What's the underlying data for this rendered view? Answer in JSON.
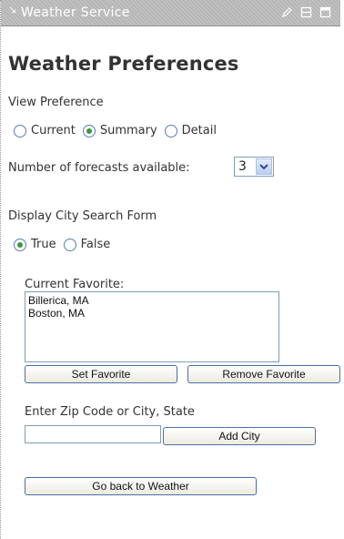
{
  "titlebar": {
    "collapse_glyph": "↘",
    "title": "Weather Service",
    "icons": [
      "edit-icon",
      "minimize-icon",
      "maximize-icon"
    ]
  },
  "heading": "Weather Preferences",
  "view_preference": {
    "label": "View Preference",
    "options": [
      {
        "label": "Current",
        "checked": false
      },
      {
        "label": "Summary",
        "checked": true
      },
      {
        "label": "Detail",
        "checked": false
      }
    ]
  },
  "forecasts": {
    "label": "Number of forecasts available:",
    "selected": "3"
  },
  "city_search": {
    "label": "Display City Search Form",
    "options": [
      {
        "label": "True",
        "checked": true
      },
      {
        "label": "False",
        "checked": false
      }
    ]
  },
  "favorites": {
    "label": "Current Favorite:",
    "items": [
      "Billerica, MA",
      "Boston, MA"
    ]
  },
  "buttons": {
    "set_favorite": "Set Favorite",
    "remove_favorite": "Remove Favorite",
    "add_city": "Add City",
    "go_back": "Go back to Weather"
  },
  "zip": {
    "label": "Enter Zip Code or City, State",
    "value": ""
  },
  "colors": {
    "titlebar_bg": "#b6b6b6",
    "radio_dot": "#3a9a3a",
    "button_border": "#4d6fa8"
  }
}
